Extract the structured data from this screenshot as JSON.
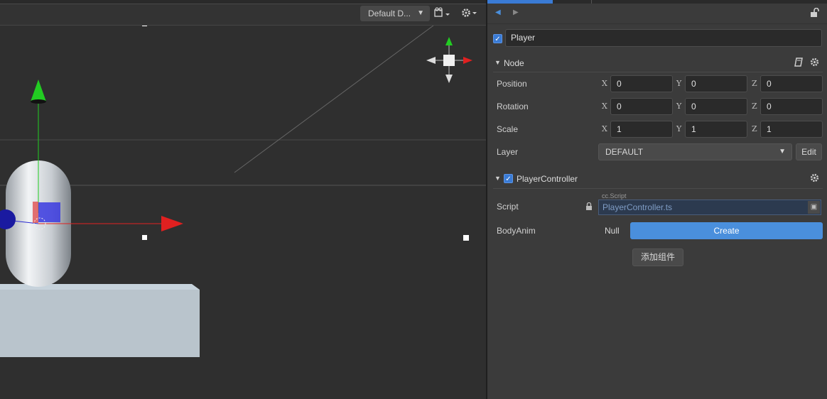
{
  "scene": {
    "camera_select": "Default D...",
    "camera_icon": "camera-icon",
    "settings_icon": "gear-icon"
  },
  "inspector": {
    "node_name": "Player",
    "node_enabled": true,
    "node_section": {
      "title": "Node",
      "labels": {
        "position": "Position",
        "rotation": "Rotation",
        "scale": "Scale",
        "layer": "Layer"
      },
      "axes": {
        "x": "X",
        "y": "Y",
        "z": "Z"
      },
      "position": {
        "x": "0",
        "y": "0",
        "z": "0"
      },
      "rotation": {
        "x": "0",
        "y": "0",
        "z": "0"
      },
      "scale": {
        "x": "1",
        "y": "1",
        "z": "1"
      },
      "layer_value": "DEFAULT",
      "edit_label": "Edit"
    },
    "component": {
      "title": "PlayerController",
      "enabled": true,
      "script_label": "Script",
      "script_tag": "cc.Script",
      "script_value": "PlayerController.ts",
      "body_anim_label": "BodyAnim",
      "body_anim_value": "Null",
      "create_label": "Create"
    },
    "add_component_label": "添加组件"
  },
  "colors": {
    "accent": "#3a7bd5",
    "create_button": "#4a8fdc",
    "gizmo_x": "#e02020",
    "gizmo_y": "#22cc22",
    "gizmo_z": "#2a2ad0"
  }
}
